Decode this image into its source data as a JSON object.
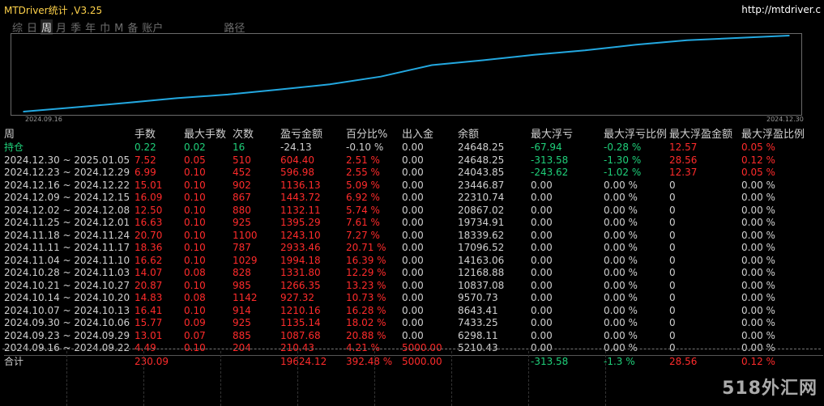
{
  "header": {
    "title": "MTDriver统计 ,V3.25",
    "url": "http://mtdriver.c"
  },
  "tabs": [
    {
      "label": "综"
    },
    {
      "label": "日"
    },
    {
      "label": "周",
      "active": true
    },
    {
      "label": "月"
    },
    {
      "label": "季"
    },
    {
      "label": "年"
    },
    {
      "label": "巾"
    },
    {
      "label": "M"
    },
    {
      "label": "备"
    },
    {
      "label": "账户"
    },
    {
      "label": "路径",
      "gap": true
    }
  ],
  "chart": {
    "start_label": "2024.09.16",
    "end_label": "2024.12.30",
    "line_color": "#23a8e0"
  },
  "chart_data": {
    "type": "line",
    "xlabel": "",
    "ylabel": "",
    "x": [
      "2024.09.16",
      "2024.09.23",
      "2024.09.30",
      "2024.10.07",
      "2024.10.14",
      "2024.10.21",
      "2024.10.28",
      "2024.11.04",
      "2024.11.11",
      "2024.11.18",
      "2024.11.25",
      "2024.12.02",
      "2024.12.09",
      "2024.12.16",
      "2024.12.23",
      "2024.12.30"
    ],
    "values": [
      5210.43,
      6298.11,
      7433.25,
      8643.41,
      9570.73,
      10837.08,
      12168.88,
      14163.06,
      17096.52,
      18339.62,
      19734.91,
      20867.02,
      22310.74,
      23446.87,
      24043.85,
      24648.25
    ]
  },
  "table": {
    "headers": [
      "周",
      "手数",
      "最大手数",
      "次数",
      "盈亏金额",
      "百分比%",
      "出入金",
      "余额",
      "最大浮亏",
      "最大浮亏比例",
      "最大浮盈金额",
      "最大浮盈比例"
    ],
    "holdings": {
      "period": "持仓",
      "lots": "0.22",
      "max_lots": "0.02",
      "count": "16",
      "pnl": "-24.13",
      "pct": "-0.10 %",
      "flow": "0.00",
      "balance": "24648.25",
      "max_float_loss": "-67.94",
      "max_float_loss_pct": "-0.28 %",
      "max_float_profit": "12.57",
      "max_float_profit_pct": "0.05 %"
    },
    "rows": [
      {
        "period": "2024.12.30 ~ 2025.01.05",
        "lots": "7.52",
        "max_lots": "0.05",
        "count": "510",
        "pnl": "604.40",
        "pct": "2.51 %",
        "flow": "0.00",
        "balance": "24648.25",
        "max_float_loss": "-313.58",
        "max_float_loss_pct": "-1.30 %",
        "max_float_profit": "28.56",
        "max_float_profit_pct": "0.12 %"
      },
      {
        "period": "2024.12.23 ~ 2024.12.29",
        "lots": "6.99",
        "max_lots": "0.10",
        "count": "452",
        "pnl": "596.98",
        "pct": "2.55 %",
        "flow": "0.00",
        "balance": "24043.85",
        "max_float_loss": "-243.62",
        "max_float_loss_pct": "-1.02 %",
        "max_float_profit": "12.37",
        "max_float_profit_pct": "0.05 %"
      },
      {
        "period": "2024.12.16 ~ 2024.12.22",
        "lots": "15.01",
        "max_lots": "0.10",
        "count": "902",
        "pnl": "1136.13",
        "pct": "5.09 %",
        "flow": "0.00",
        "balance": "23446.87",
        "max_float_loss": "0.00",
        "max_float_loss_pct": "0.00 %",
        "max_float_profit": "0",
        "max_float_profit_pct": "0.00 %"
      },
      {
        "period": "2024.12.09 ~ 2024.12.15",
        "lots": "16.09",
        "max_lots": "0.10",
        "count": "867",
        "pnl": "1443.72",
        "pct": "6.92 %",
        "flow": "0.00",
        "balance": "22310.74",
        "max_float_loss": "0.00",
        "max_float_loss_pct": "0.00 %",
        "max_float_profit": "0",
        "max_float_profit_pct": "0.00 %"
      },
      {
        "period": "2024.12.02 ~ 2024.12.08",
        "lots": "12.50",
        "max_lots": "0.10",
        "count": "880",
        "pnl": "1132.11",
        "pct": "5.74 %",
        "flow": "0.00",
        "balance": "20867.02",
        "max_float_loss": "0.00",
        "max_float_loss_pct": "0.00 %",
        "max_float_profit": "0",
        "max_float_profit_pct": "0.00 %"
      },
      {
        "period": "2024.11.25 ~ 2024.12.01",
        "lots": "16.63",
        "max_lots": "0.10",
        "count": "925",
        "pnl": "1395.29",
        "pct": "7.61 %",
        "flow": "0.00",
        "balance": "19734.91",
        "max_float_loss": "0.00",
        "max_float_loss_pct": "0.00 %",
        "max_float_profit": "0",
        "max_float_profit_pct": "0.00 %"
      },
      {
        "period": "2024.11.18 ~ 2024.11.24",
        "lots": "20.70",
        "max_lots": "0.10",
        "count": "1100",
        "pnl": "1243.10",
        "pct": "7.27 %",
        "flow": "0.00",
        "balance": "18339.62",
        "max_float_loss": "0.00",
        "max_float_loss_pct": "0.00 %",
        "max_float_profit": "0",
        "max_float_profit_pct": "0.00 %"
      },
      {
        "period": "2024.11.11 ~ 2024.11.17",
        "lots": "18.36",
        "max_lots": "0.10",
        "count": "787",
        "pnl": "2933.46",
        "pct": "20.71 %",
        "flow": "0.00",
        "balance": "17096.52",
        "max_float_loss": "0.00",
        "max_float_loss_pct": "0.00 %",
        "max_float_profit": "0",
        "max_float_profit_pct": "0.00 %"
      },
      {
        "period": "2024.11.04 ~ 2024.11.10",
        "lots": "16.62",
        "max_lots": "0.10",
        "count": "1029",
        "pnl": "1994.18",
        "pct": "16.39 %",
        "flow": "0.00",
        "balance": "14163.06",
        "max_float_loss": "0.00",
        "max_float_loss_pct": "0.00 %",
        "max_float_profit": "0",
        "max_float_profit_pct": "0.00 %"
      },
      {
        "period": "2024.10.28 ~ 2024.11.03",
        "lots": "14.07",
        "max_lots": "0.08",
        "count": "828",
        "pnl": "1331.80",
        "pct": "12.29 %",
        "flow": "0.00",
        "balance": "12168.88",
        "max_float_loss": "0.00",
        "max_float_loss_pct": "0.00 %",
        "max_float_profit": "0",
        "max_float_profit_pct": "0.00 %"
      },
      {
        "period": "2024.10.21 ~ 2024.10.27",
        "lots": "20.87",
        "max_lots": "0.10",
        "count": "985",
        "pnl": "1266.35",
        "pct": "13.23 %",
        "flow": "0.00",
        "balance": "10837.08",
        "max_float_loss": "0.00",
        "max_float_loss_pct": "0.00 %",
        "max_float_profit": "0",
        "max_float_profit_pct": "0.00 %"
      },
      {
        "period": "2024.10.14 ~ 2024.10.20",
        "lots": "14.83",
        "max_lots": "0.08",
        "count": "1142",
        "pnl": "927.32",
        "pct": "10.73 %",
        "flow": "0.00",
        "balance": "9570.73",
        "max_float_loss": "0.00",
        "max_float_loss_pct": "0.00 %",
        "max_float_profit": "0",
        "max_float_profit_pct": "0.00 %"
      },
      {
        "period": "2024.10.07 ~ 2024.10.13",
        "lots": "16.41",
        "max_lots": "0.10",
        "count": "914",
        "pnl": "1210.16",
        "pct": "16.28 %",
        "flow": "0.00",
        "balance": "8643.41",
        "max_float_loss": "0.00",
        "max_float_loss_pct": "0.00 %",
        "max_float_profit": "0",
        "max_float_profit_pct": "0.00 %"
      },
      {
        "period": "2024.09.30 ~ 2024.10.06",
        "lots": "15.77",
        "max_lots": "0.09",
        "count": "925",
        "pnl": "1135.14",
        "pct": "18.02 %",
        "flow": "0.00",
        "balance": "7433.25",
        "max_float_loss": "0.00",
        "max_float_loss_pct": "0.00 %",
        "max_float_profit": "0",
        "max_float_profit_pct": "0.00 %"
      },
      {
        "period": "2024.09.23 ~ 2024.09.29",
        "lots": "13.01",
        "max_lots": "0.07",
        "count": "885",
        "pnl": "1087.68",
        "pct": "20.88 %",
        "flow": "0.00",
        "balance": "6298.11",
        "max_float_loss": "0.00",
        "max_float_loss_pct": "0.00 %",
        "max_float_profit": "0",
        "max_float_profit_pct": "0.00 %"
      },
      {
        "period": "2024.09.16 ~ 2024.09.22",
        "lots": "4.49",
        "max_lots": "0.10",
        "count": "204",
        "pnl": "210.43",
        "pct": "4.21 %",
        "flow": "5000.00",
        "balance": "5210.43",
        "max_float_loss": "0.00",
        "max_float_loss_pct": "0.00 %",
        "max_float_profit": "0",
        "max_float_profit_pct": "0.00 %"
      }
    ],
    "total": {
      "period": "合计",
      "lots": "230.09",
      "max_lots": "",
      "count": "",
      "pnl": "19624.12",
      "pct": "392.48 %",
      "flow": "5000.00",
      "balance": "",
      "max_float_loss": "-313.58",
      "max_float_loss_pct": "-1.3 %",
      "max_float_profit": "28.56",
      "max_float_profit_pct": "0.12 %"
    }
  },
  "watermark": "518外汇网"
}
